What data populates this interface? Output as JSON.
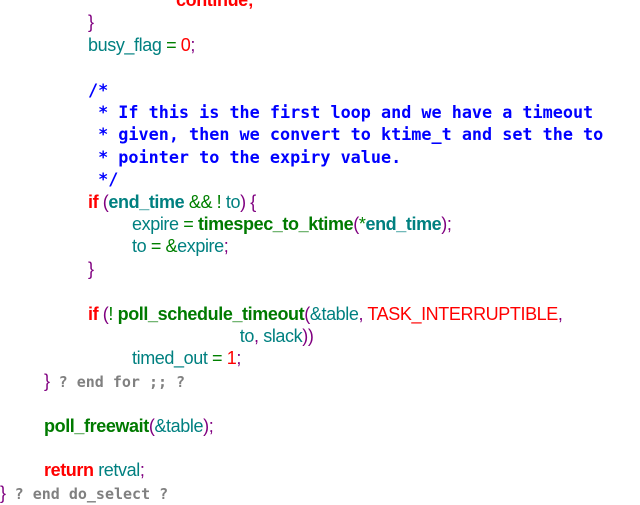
{
  "editor": {
    "lines": [
      {
        "indent": 4,
        "tokens": [
          {
            "t": "continue;",
            "c": "kw"
          }
        ]
      },
      {
        "indent": 2,
        "tokens": [
          {
            "t": "}",
            "c": "br"
          }
        ]
      },
      {
        "indent": 2,
        "tokens": [
          {
            "t": "busy_flag",
            "c": "id"
          },
          {
            "t": " = ",
            "c": "op"
          },
          {
            "t": "0",
            "c": "num"
          },
          {
            "t": ";",
            "c": "br"
          }
        ]
      },
      {
        "indent": 2,
        "tokens": []
      },
      {
        "indent": 2,
        "tokens": [
          {
            "t": "/*",
            "c": "cm"
          }
        ]
      },
      {
        "indent": 2,
        "tokens": [
          {
            "t": " * If this is the first loop and we have a timeout",
            "c": "cm"
          }
        ]
      },
      {
        "indent": 2,
        "tokens": [
          {
            "t": " * given, then we convert to ktime_t and set the to",
            "c": "cm"
          }
        ]
      },
      {
        "indent": 2,
        "tokens": [
          {
            "t": " * pointer to the expiry value.",
            "c": "cm"
          }
        ]
      },
      {
        "indent": 2,
        "tokens": [
          {
            "t": " */",
            "c": "cm"
          }
        ]
      },
      {
        "indent": 2,
        "tokens": [
          {
            "t": "if",
            "c": "kw"
          },
          {
            "t": " (",
            "c": "br"
          },
          {
            "t": "end_time",
            "c": "idb"
          },
          {
            "t": " && ! ",
            "c": "op"
          },
          {
            "t": "to",
            "c": "id"
          },
          {
            "t": ") {",
            "c": "br"
          }
        ]
      },
      {
        "indent": 3,
        "tokens": [
          {
            "t": "expire",
            "c": "id"
          },
          {
            "t": " = ",
            "c": "op"
          },
          {
            "t": "timespec_to_ktime",
            "c": "fn"
          },
          {
            "t": "(",
            "c": "br"
          },
          {
            "t": "*",
            "c": "op"
          },
          {
            "t": "end_time",
            "c": "idb"
          },
          {
            "t": ");",
            "c": "br"
          }
        ]
      },
      {
        "indent": 3,
        "tokens": [
          {
            "t": "to",
            "c": "id"
          },
          {
            "t": " = &",
            "c": "op"
          },
          {
            "t": "expire",
            "c": "id"
          },
          {
            "t": ";",
            "c": "br"
          }
        ]
      },
      {
        "indent": 2,
        "tokens": [
          {
            "t": "}",
            "c": "br"
          }
        ]
      },
      {
        "indent": 2,
        "tokens": []
      },
      {
        "indent": 2,
        "tokens": [
          {
            "t": "if",
            "c": "kw"
          },
          {
            "t": " (",
            "c": "br"
          },
          {
            "t": "! ",
            "c": "op"
          },
          {
            "t": "poll_schedule_timeout",
            "c": "fn"
          },
          {
            "t": "(",
            "c": "br"
          },
          {
            "t": "&table",
            "c": "id"
          },
          {
            "t": ", ",
            "c": "br"
          },
          {
            "t": "TASK_INTERRUPTIBLE",
            "c": "cst"
          },
          {
            "t": ",",
            "c": "br"
          }
        ]
      },
      {
        "indent": 5.45,
        "tokens": [
          {
            "t": "to",
            "c": "id"
          },
          {
            "t": ", ",
            "c": "br"
          },
          {
            "t": "slack",
            "c": "id"
          },
          {
            "t": "))",
            "c": "br"
          }
        ]
      },
      {
        "indent": 3,
        "tokens": [
          {
            "t": "timed_out",
            "c": "id"
          },
          {
            "t": " = ",
            "c": "op"
          },
          {
            "t": "1",
            "c": "num"
          },
          {
            "t": ";",
            "c": "br"
          }
        ]
      },
      {
        "indent": 1,
        "tokens": [
          {
            "t": "}",
            "c": "br"
          },
          {
            "t": " ? end for ;; ?",
            "c": "gr"
          }
        ]
      },
      {
        "indent": 1,
        "tokens": []
      },
      {
        "indent": 1,
        "tokens": [
          {
            "t": "poll_freewait",
            "c": "fn"
          },
          {
            "t": "(",
            "c": "br"
          },
          {
            "t": "&table",
            "c": "id"
          },
          {
            "t": ");",
            "c": "br"
          }
        ]
      },
      {
        "indent": 1,
        "tokens": []
      },
      {
        "indent": 1,
        "tokens": [
          {
            "t": "return",
            "c": "kw"
          },
          {
            "t": " retval",
            "c": "id"
          },
          {
            "t": ";",
            "c": "br"
          }
        ]
      },
      {
        "indent": 0,
        "tokens": [
          {
            "t": "}",
            "c": "br"
          },
          {
            "t": " ? end do_select ?",
            "c": "gr"
          }
        ]
      }
    ]
  }
}
